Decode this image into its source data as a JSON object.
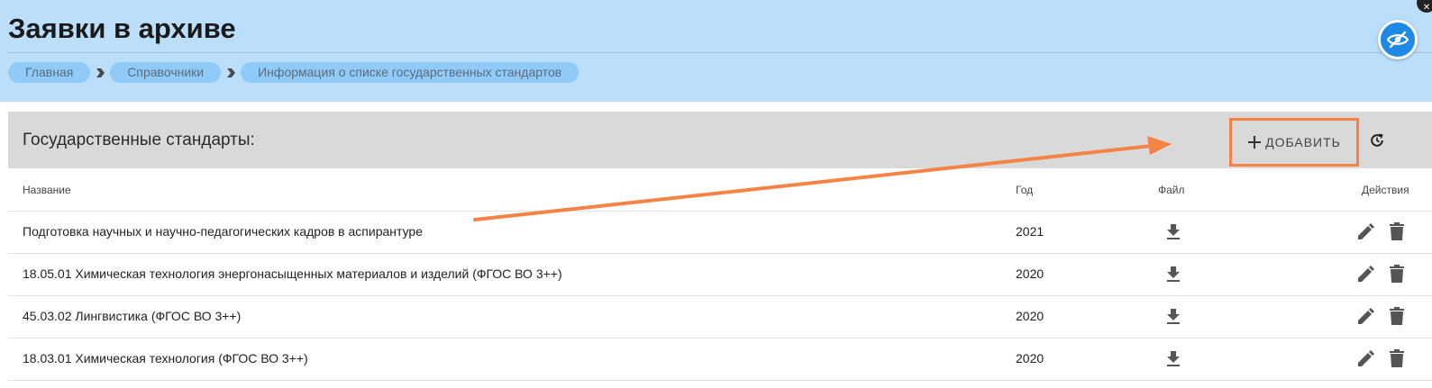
{
  "page": {
    "title": "Заявки в архиве",
    "breadcrumbs": [
      {
        "label": "Главная"
      },
      {
        "label": "Справочники"
      },
      {
        "label": "Информация о списке государственных стандартов"
      }
    ]
  },
  "icons": {
    "breadcrumb_separator": "chevron-right-icon",
    "visibility": "eye-off-icon",
    "add": "plus-icon",
    "refresh": "refresh-icon",
    "download": "download-icon",
    "edit": "pencil-icon",
    "delete": "trash-icon"
  },
  "colors": {
    "header_background": "#bbdefb",
    "breadcrumb_pill": "#90caf9",
    "card_header": "#d9d9d9",
    "accent_button": "#1e88e5",
    "annotation": "#f58345"
  },
  "card": {
    "title": "Государственные стандарты:",
    "add_label": "ДОБАВИТЬ"
  },
  "table": {
    "columns": {
      "name": "Название",
      "year": "Год",
      "file": "Файл",
      "actions": "Действия"
    },
    "rows": [
      {
        "name": "Подготовка научных и научно-педагогических кадров в аспирантуре",
        "year": "2021"
      },
      {
        "name": "18.05.01 Химическая технология энергонасыщенных материалов и изделий (ФГОС ВО 3++)",
        "year": "2020"
      },
      {
        "name": "45.03.02 Лингвистика (ФГОС ВО 3++)",
        "year": "2020"
      },
      {
        "name": "18.03.01 Химическая технология (ФГОС ВО 3++)",
        "year": "2020"
      }
    ]
  }
}
